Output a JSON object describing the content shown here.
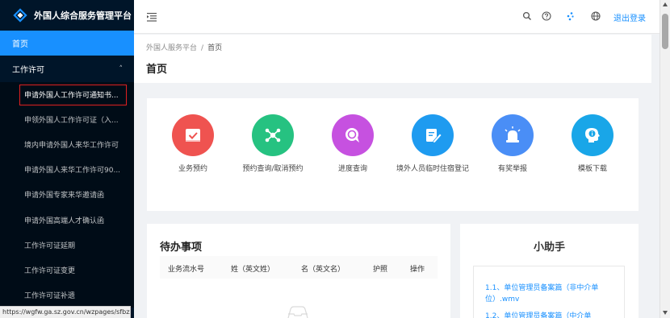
{
  "app": {
    "title": "外国人综合服务管理平台",
    "brand_color": "#1890ff",
    "sidebar_bg": "#001529"
  },
  "sidebar": {
    "home_label": "首页",
    "group_label": "工作许可",
    "group_chevron": "˄",
    "items": [
      {
        "label": "申请外国人工作许可通知书...",
        "active": true
      },
      {
        "label": "申领外国人工作许可证（入..."
      },
      {
        "label": "境内申请外国人来华工作许可"
      },
      {
        "label": "申请外国人来华工作许可90..."
      },
      {
        "label": "申请外国专家来华邀请函"
      },
      {
        "label": "申请外国高端人才确认函"
      },
      {
        "label": "工作许可证延期"
      },
      {
        "label": "工作许可证变更"
      },
      {
        "label": "工作许可证补遗"
      }
    ]
  },
  "status_url": "https://wgfw.ga.sz.gov.cn/wzpages/sfbzzy/13",
  "header": {
    "icons": [
      "search-icon",
      "help-icon",
      "apps-icon",
      "globe-icon"
    ],
    "logout_label": "退出登录"
  },
  "breadcrumb": {
    "root": "外国人服务平台",
    "separator": "/",
    "current": "首页"
  },
  "page_title": "首页",
  "services": [
    {
      "label": "业务预约",
      "icon": "calendar-check-icon",
      "color": "#ef5350"
    },
    {
      "label": "预约查询/取消预约",
      "icon": "network-icon",
      "color": "#26c281"
    },
    {
      "label": "进度查询",
      "icon": "chat-search-icon",
      "color": "#c651e0"
    },
    {
      "label": "境外人员临时住宿登记",
      "icon": "edit-pen-icon",
      "color": "#1e9bf0"
    },
    {
      "label": "有奖举报",
      "icon": "alarm-light-icon",
      "color": "#4a8ef6"
    },
    {
      "label": "模板下载",
      "icon": "info-head-icon",
      "color": "#19a6e8"
    }
  ],
  "todo": {
    "title": "待办事项",
    "columns": [
      "业务流水号",
      "姓（英文姓）",
      "名（英文名）",
      "护照",
      "操作"
    ]
  },
  "helper": {
    "title": "小助手",
    "links": [
      "1.1、单位管理员备案篇（非中介单位）.wmv",
      "1.2、单位管理员备案篇（中介单"
    ]
  }
}
